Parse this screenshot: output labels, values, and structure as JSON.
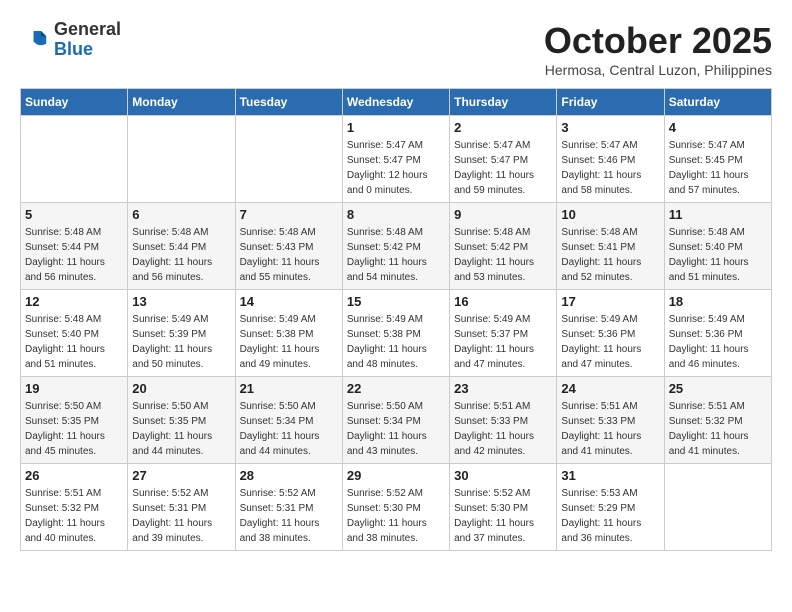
{
  "header": {
    "logo": {
      "line1": "General",
      "line2": "Blue"
    },
    "title": "October 2025",
    "subtitle": "Hermosa, Central Luzon, Philippines"
  },
  "weekdays": [
    "Sunday",
    "Monday",
    "Tuesday",
    "Wednesday",
    "Thursday",
    "Friday",
    "Saturday"
  ],
  "weeks": [
    [
      null,
      null,
      null,
      {
        "day": 1,
        "sunrise": "5:47 AM",
        "sunset": "5:47 PM",
        "daylight": "12 hours and 0 minutes."
      },
      {
        "day": 2,
        "sunrise": "5:47 AM",
        "sunset": "5:47 PM",
        "daylight": "11 hours and 59 minutes."
      },
      {
        "day": 3,
        "sunrise": "5:47 AM",
        "sunset": "5:46 PM",
        "daylight": "11 hours and 58 minutes."
      },
      {
        "day": 4,
        "sunrise": "5:47 AM",
        "sunset": "5:45 PM",
        "daylight": "11 hours and 57 minutes."
      }
    ],
    [
      {
        "day": 5,
        "sunrise": "5:48 AM",
        "sunset": "5:44 PM",
        "daylight": "11 hours and 56 minutes."
      },
      {
        "day": 6,
        "sunrise": "5:48 AM",
        "sunset": "5:44 PM",
        "daylight": "11 hours and 56 minutes."
      },
      {
        "day": 7,
        "sunrise": "5:48 AM",
        "sunset": "5:43 PM",
        "daylight": "11 hours and 55 minutes."
      },
      {
        "day": 8,
        "sunrise": "5:48 AM",
        "sunset": "5:42 PM",
        "daylight": "11 hours and 54 minutes."
      },
      {
        "day": 9,
        "sunrise": "5:48 AM",
        "sunset": "5:42 PM",
        "daylight": "11 hours and 53 minutes."
      },
      {
        "day": 10,
        "sunrise": "5:48 AM",
        "sunset": "5:41 PM",
        "daylight": "11 hours and 52 minutes."
      },
      {
        "day": 11,
        "sunrise": "5:48 AM",
        "sunset": "5:40 PM",
        "daylight": "11 hours and 51 minutes."
      }
    ],
    [
      {
        "day": 12,
        "sunrise": "5:48 AM",
        "sunset": "5:40 PM",
        "daylight": "11 hours and 51 minutes."
      },
      {
        "day": 13,
        "sunrise": "5:49 AM",
        "sunset": "5:39 PM",
        "daylight": "11 hours and 50 minutes."
      },
      {
        "day": 14,
        "sunrise": "5:49 AM",
        "sunset": "5:38 PM",
        "daylight": "11 hours and 49 minutes."
      },
      {
        "day": 15,
        "sunrise": "5:49 AM",
        "sunset": "5:38 PM",
        "daylight": "11 hours and 48 minutes."
      },
      {
        "day": 16,
        "sunrise": "5:49 AM",
        "sunset": "5:37 PM",
        "daylight": "11 hours and 47 minutes."
      },
      {
        "day": 17,
        "sunrise": "5:49 AM",
        "sunset": "5:36 PM",
        "daylight": "11 hours and 47 minutes."
      },
      {
        "day": 18,
        "sunrise": "5:49 AM",
        "sunset": "5:36 PM",
        "daylight": "11 hours and 46 minutes."
      }
    ],
    [
      {
        "day": 19,
        "sunrise": "5:50 AM",
        "sunset": "5:35 PM",
        "daylight": "11 hours and 45 minutes."
      },
      {
        "day": 20,
        "sunrise": "5:50 AM",
        "sunset": "5:35 PM",
        "daylight": "11 hours and 44 minutes."
      },
      {
        "day": 21,
        "sunrise": "5:50 AM",
        "sunset": "5:34 PM",
        "daylight": "11 hours and 44 minutes."
      },
      {
        "day": 22,
        "sunrise": "5:50 AM",
        "sunset": "5:34 PM",
        "daylight": "11 hours and 43 minutes."
      },
      {
        "day": 23,
        "sunrise": "5:51 AM",
        "sunset": "5:33 PM",
        "daylight": "11 hours and 42 minutes."
      },
      {
        "day": 24,
        "sunrise": "5:51 AM",
        "sunset": "5:33 PM",
        "daylight": "11 hours and 41 minutes."
      },
      {
        "day": 25,
        "sunrise": "5:51 AM",
        "sunset": "5:32 PM",
        "daylight": "11 hours and 41 minutes."
      }
    ],
    [
      {
        "day": 26,
        "sunrise": "5:51 AM",
        "sunset": "5:32 PM",
        "daylight": "11 hours and 40 minutes."
      },
      {
        "day": 27,
        "sunrise": "5:52 AM",
        "sunset": "5:31 PM",
        "daylight": "11 hours and 39 minutes."
      },
      {
        "day": 28,
        "sunrise": "5:52 AM",
        "sunset": "5:31 PM",
        "daylight": "11 hours and 38 minutes."
      },
      {
        "day": 29,
        "sunrise": "5:52 AM",
        "sunset": "5:30 PM",
        "daylight": "11 hours and 38 minutes."
      },
      {
        "day": 30,
        "sunrise": "5:52 AM",
        "sunset": "5:30 PM",
        "daylight": "11 hours and 37 minutes."
      },
      {
        "day": 31,
        "sunrise": "5:53 AM",
        "sunset": "5:29 PM",
        "daylight": "11 hours and 36 minutes."
      },
      null
    ]
  ]
}
